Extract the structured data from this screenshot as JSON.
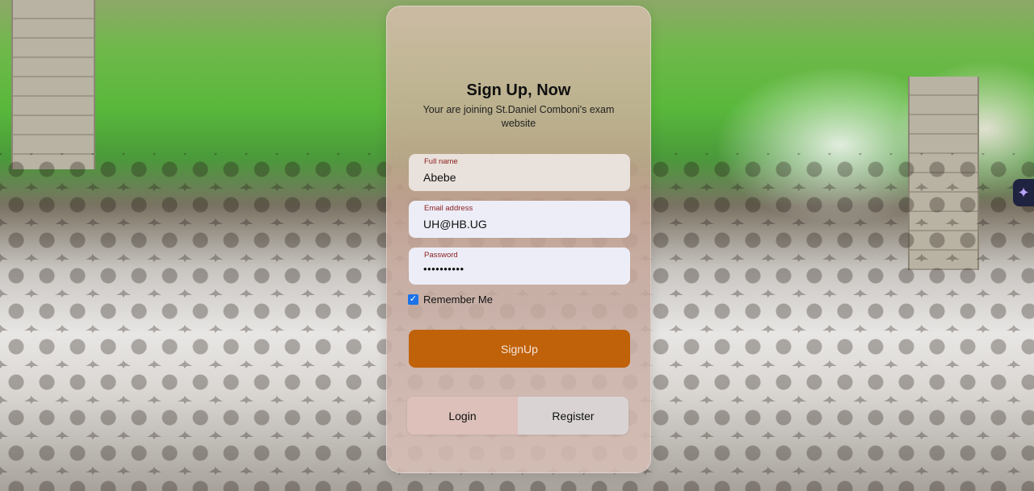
{
  "signup": {
    "title": "Sign Up, Now",
    "subtitle": "Your are joining St.Daniel Comboni's exam website",
    "fields": [
      {
        "label": "Full name",
        "value": "Abebe"
      },
      {
        "label": "Email address",
        "value": "UH@HB.UG"
      },
      {
        "label": "Password",
        "value": "••••••••••"
      }
    ],
    "remember_label": "Remember Me",
    "remember_checked": true,
    "submit_label": "SignUp",
    "toggle": {
      "login_label": "Login",
      "register_label": "Register"
    }
  },
  "colors": {
    "accent": "#c0620a",
    "label_red": "#8b1e1e",
    "checkbox_blue": "#1a73e8"
  },
  "icons": {
    "side_badge": "sparkle-icon"
  }
}
